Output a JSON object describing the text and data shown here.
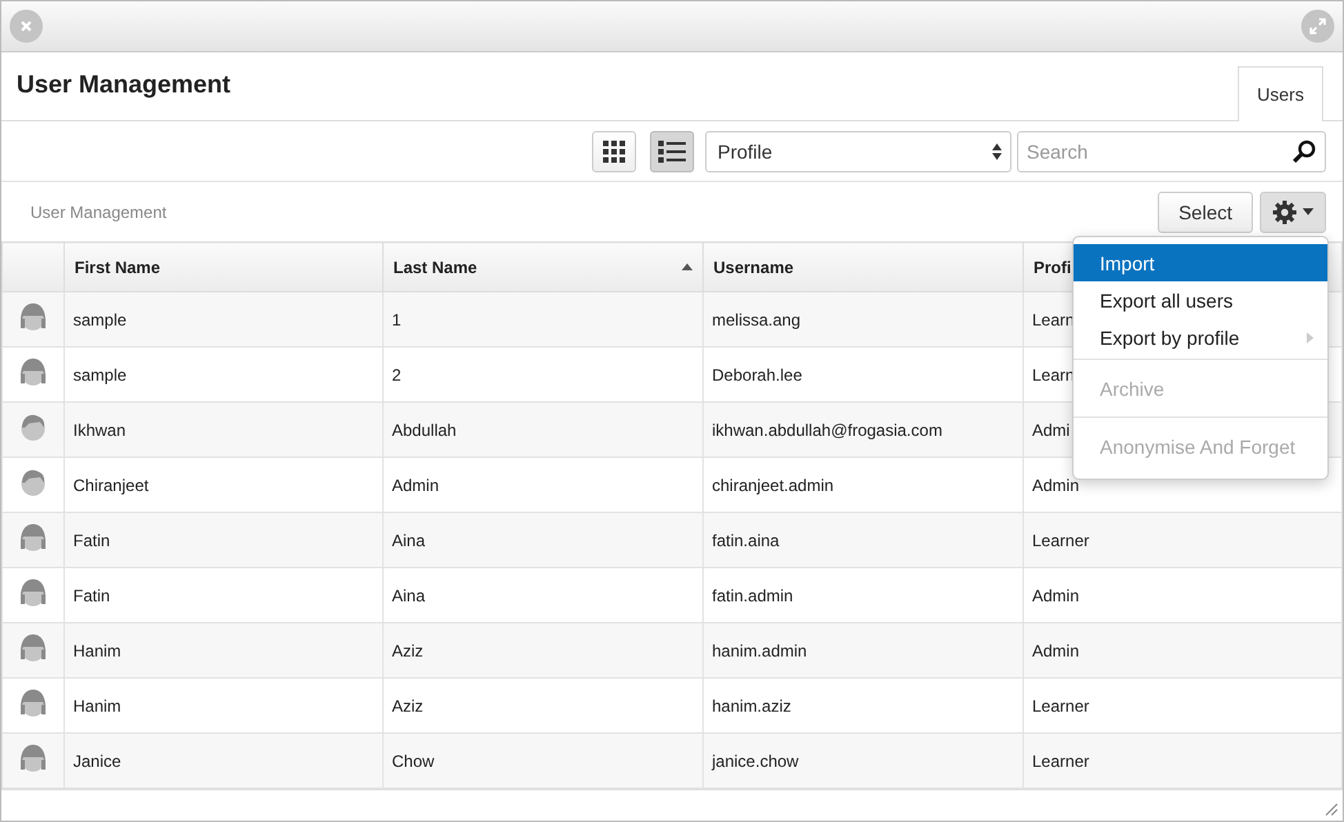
{
  "window": {
    "title": "User Management"
  },
  "tabs": [
    {
      "label": "Users",
      "selected": true
    }
  ],
  "toolbar": {
    "views": [
      {
        "kind": "grid",
        "selected": false
      },
      {
        "kind": "list",
        "selected": true
      }
    ],
    "profile_select": {
      "value": "Profile"
    },
    "search": {
      "placeholder": "Search"
    }
  },
  "breadcrumb": "User Management",
  "actions": {
    "select_button": "Select"
  },
  "table": {
    "columns": [
      {
        "label": "First Name",
        "sorted": false
      },
      {
        "label": "Last Name",
        "sorted": true
      },
      {
        "label": "Username",
        "sorted": false
      },
      {
        "label": "Profi",
        "sorted": false
      }
    ],
    "rows": [
      {
        "kind": "female",
        "cells": [
          "sample",
          "1",
          "melissa.ang",
          "Learn"
        ]
      },
      {
        "kind": "female",
        "cells": [
          "sample",
          "2",
          "Deborah.lee",
          "Learn"
        ]
      },
      {
        "kind": "male",
        "cells": [
          "Ikhwan",
          "Abdullah",
          "ikhwan.abdullah@frogasia.com",
          "Admi"
        ]
      },
      {
        "kind": "male",
        "cells": [
          "Chiranjeet",
          "Admin",
          "chiranjeet.admin",
          "Admin"
        ]
      },
      {
        "kind": "female",
        "cells": [
          "Fatin",
          "Aina",
          "fatin.aina",
          "Learner"
        ]
      },
      {
        "kind": "female",
        "cells": [
          "Fatin",
          "Aina",
          "fatin.admin",
          "Admin"
        ]
      },
      {
        "kind": "female",
        "cells": [
          "Hanim",
          "Aziz",
          "hanim.admin",
          "Admin"
        ]
      },
      {
        "kind": "female",
        "cells": [
          "Hanim",
          "Aziz",
          "hanim.aziz",
          "Learner"
        ]
      },
      {
        "kind": "female",
        "cells": [
          "Janice",
          "Chow",
          "janice.chow",
          "Learner"
        ]
      }
    ]
  },
  "menu": {
    "items": [
      {
        "label": "Import",
        "selected": true,
        "disabled": false,
        "submenu": false,
        "divider_before": false
      },
      {
        "label": "Export all users",
        "selected": false,
        "disabled": false,
        "submenu": false,
        "divider_before": false
      },
      {
        "label": "Export by profile",
        "selected": false,
        "disabled": false,
        "submenu": true,
        "divider_before": false
      },
      {
        "label": "Archive",
        "selected": false,
        "disabled": true,
        "submenu": false,
        "divider_before": true
      },
      {
        "label": "Anonymise And Forget",
        "selected": false,
        "disabled": true,
        "submenu": false,
        "divider_before": true
      }
    ]
  }
}
